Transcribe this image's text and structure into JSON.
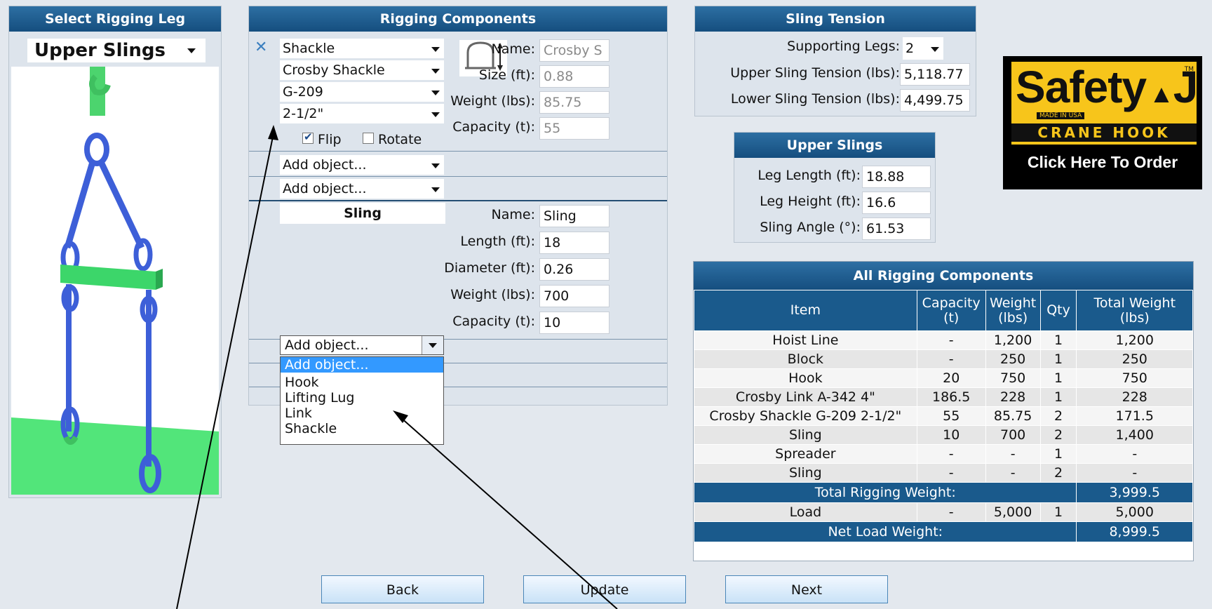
{
  "left_panel": {
    "header": "Select Rigging Leg",
    "selected": "Upper Slings"
  },
  "rigging": {
    "header": "Rigging Components",
    "remove_icon": "x-icon",
    "component1": {
      "type_select": "Shackle",
      "make_select": "Crosby Shackle",
      "model_select": "G-209",
      "size_select": "2-1/2\"",
      "flip_label": "Flip",
      "flip_checked": true,
      "rotate_label": "Rotate",
      "rotate_checked": false,
      "labels": {
        "name": "Name:",
        "size": "Size (ft):",
        "weight": "Weight (lbs):",
        "capacity": "Capacity (t):"
      },
      "values": {
        "name": "Crosby S",
        "size": "0.88",
        "weight": "85.75",
        "capacity": "55"
      }
    },
    "add_object_1": "Add object...",
    "add_object_2": "Add object...",
    "sling": {
      "title": "Sling",
      "labels": {
        "name": "Name:",
        "length": "Length (ft):",
        "diameter": "Diameter (ft):",
        "weight": "Weight (lbs):",
        "capacity": "Capacity (t):"
      },
      "values": {
        "name": "Sling",
        "length": "18",
        "diameter": "0.26",
        "weight": "700",
        "capacity": "10"
      }
    },
    "add_object_3": "Add object...",
    "dropdown_options": [
      "Add object...",
      "Hook",
      "Lifting Lug",
      "Link",
      "Shackle"
    ],
    "dropdown_selected_index": 0
  },
  "tension": {
    "header": "Sling Tension",
    "supporting_legs_label": "Supporting Legs:",
    "supporting_legs_value": "2",
    "upper_label": "Upper Sling Tension (lbs):",
    "upper_value": "5,118.77",
    "lower_label": "Lower Sling Tension (lbs):",
    "lower_value": "4,499.75"
  },
  "upper_slings": {
    "header": "Upper Slings",
    "leg_length_label": "Leg Length (ft):",
    "leg_length_value": "18.88",
    "leg_height_label": "Leg Height (ft):",
    "leg_height_value": "16.6",
    "angle_label": "Sling Angle (°):",
    "angle_value": "61.53"
  },
  "ad": {
    "brand": "Safety",
    "brand_suffix": "J",
    "made_in": "MADE IN USA",
    "tm": "TM",
    "tagline": "CRANE HOOK",
    "cta": "Click Here To Order"
  },
  "all_components": {
    "header": "All Rigging Components",
    "columns": [
      "Item",
      "Capacity (t)",
      "Weight (lbs)",
      "Qty",
      "Total Weight (lbs)"
    ],
    "rows": [
      [
        "Hoist Line",
        "-",
        "1,200",
        "1",
        "1,200"
      ],
      [
        "Block",
        "-",
        "250",
        "1",
        "250"
      ],
      [
        "Hook",
        "20",
        "750",
        "1",
        "750"
      ],
      [
        "Crosby Link A-342 4\"",
        "186.5",
        "228",
        "1",
        "228"
      ],
      [
        "Crosby Shackle G-209 2-1/2\"",
        "55",
        "85.75",
        "2",
        "171.5"
      ],
      [
        "Sling",
        "10",
        "700",
        "2",
        "1,400"
      ],
      [
        "Spreader",
        "-",
        "-",
        "1",
        "-"
      ],
      [
        "Sling",
        "-",
        "-",
        "2",
        "-"
      ]
    ],
    "total_rigging_label": "Total Rigging Weight:",
    "total_rigging_value": "3,999.5",
    "load_row": [
      "Load",
      "-",
      "5,000",
      "1",
      "5,000"
    ],
    "net_label": "Net Load Weight:",
    "net_value": "8,999.5"
  },
  "buttons": {
    "back": "Back",
    "update": "Update",
    "next": "Next"
  },
  "colors": {
    "header": "#1a5a8c",
    "background": "#e3e8ee",
    "selection": "#3399ff",
    "model_green": "#3cd66a",
    "model_blue": "#3d5fd8"
  }
}
